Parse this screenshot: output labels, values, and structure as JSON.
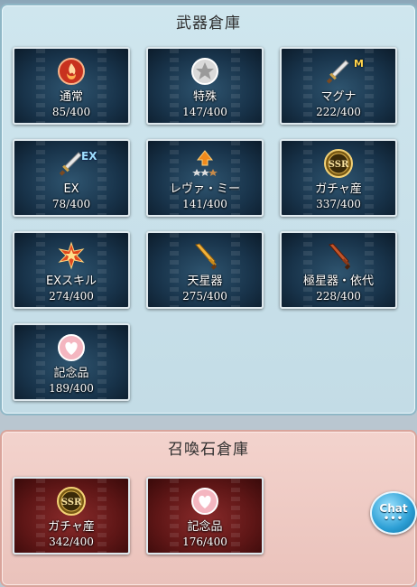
{
  "weapons": {
    "title": "武器倉庫",
    "tiles": [
      {
        "label": "通常",
        "count": "85/400",
        "icon": "fire-emblem-icon"
      },
      {
        "label": "特殊",
        "count": "147/400",
        "icon": "star-medal-icon"
      },
      {
        "label": "マグナ",
        "count": "222/400",
        "icon": "magna-sword-icon",
        "badge": "M"
      },
      {
        "label": "EX",
        "count": "78/400",
        "icon": "ex-sword-icon",
        "badge": "EX"
      },
      {
        "label": "レヴァ・ミー",
        "count": "141/400",
        "icon": "upgrade-stars-icon"
      },
      {
        "label": "ガチャ産",
        "count": "337/400",
        "icon": "ssr-medal-icon"
      },
      {
        "label": "EXスキル",
        "count": "274/400",
        "icon": "ex-skill-burst-icon"
      },
      {
        "label": "天星器",
        "count": "275/400",
        "icon": "revenant-sword-icon"
      },
      {
        "label": "極星器・依代",
        "count": "228/400",
        "icon": "dark-sword-icon"
      },
      {
        "label": "記念品",
        "count": "189/400",
        "icon": "heart-medal-icon"
      }
    ]
  },
  "summons": {
    "title": "召喚石倉庫",
    "tiles": [
      {
        "label": "ガチャ産",
        "count": "342/400",
        "icon": "ssr-medal-icon"
      },
      {
        "label": "記念品",
        "count": "176/400",
        "icon": "heart-medal-icon"
      }
    ]
  },
  "chat": {
    "label": "Chat",
    "dots": "•••"
  },
  "colors": {
    "weapon_panel": "#c9e2eb",
    "summon_panel": "#f0cbc4",
    "weapon_tile": "#18334a",
    "summon_tile": "#5e1616",
    "chat_button": "#2b9ed4"
  }
}
